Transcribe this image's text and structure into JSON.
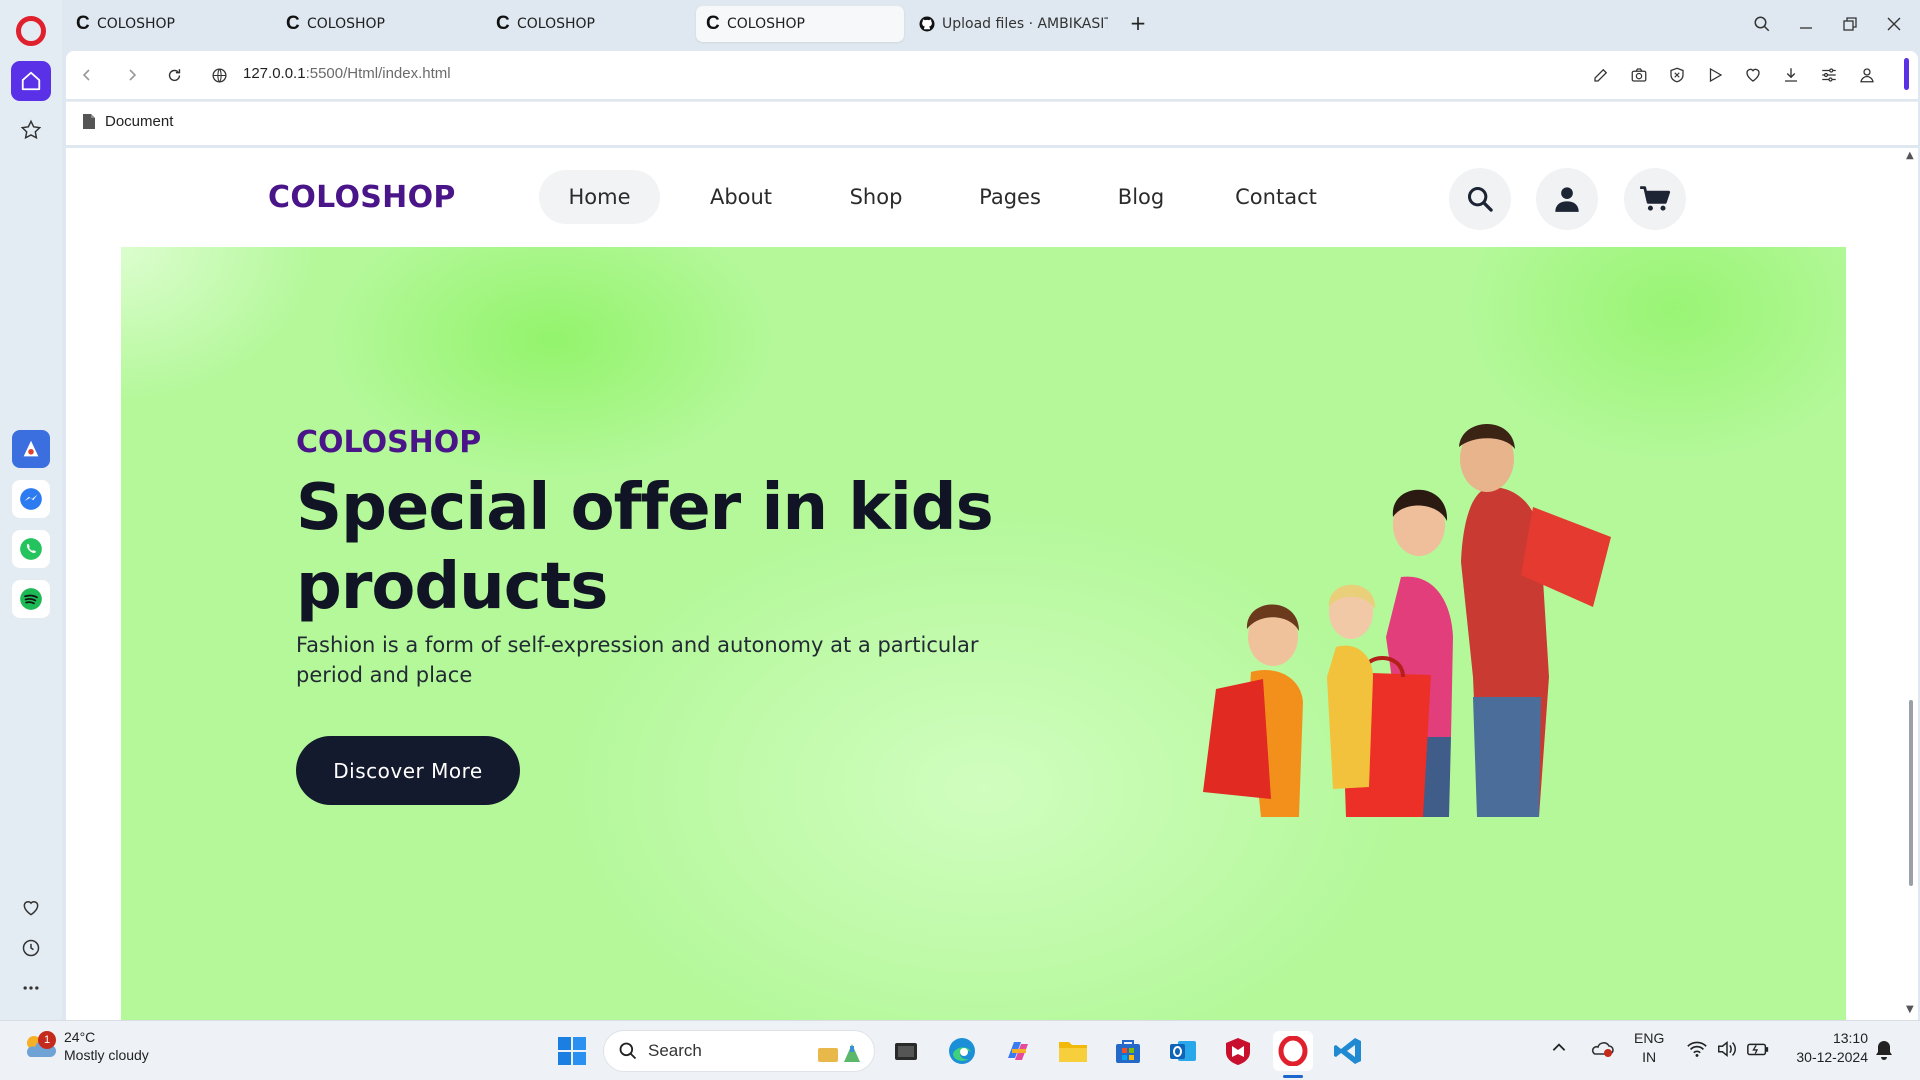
{
  "browser": {
    "tabs": [
      {
        "favicon": "C",
        "title": "COLOSHOP",
        "active": false
      },
      {
        "favicon": "C",
        "title": "COLOSHOP",
        "active": false
      },
      {
        "favicon": "C",
        "title": "COLOSHOP",
        "active": false
      },
      {
        "favicon": "C",
        "title": "COLOSHOP",
        "active": true
      },
      {
        "favicon": "github-icon",
        "title": "Upload files · AMBIKASITH",
        "active": false
      }
    ],
    "new_tab": "+",
    "url_host": "127.0.0.1",
    "url_path": ":5500/Html/index.html",
    "bookmark": "Document",
    "accent": "#5b31e7"
  },
  "site": {
    "logo": "COLOSHOP",
    "menu": [
      "Home",
      "About",
      "Shop",
      "Pages",
      "Blog",
      "Contact"
    ],
    "active_menu": "Home",
    "icons": [
      "search-icon",
      "user-icon",
      "cart-icon"
    ],
    "brand_color": "#4a1588"
  },
  "hero": {
    "kicker": "COLOSHOP",
    "title": "Special offer in kids products",
    "description": "Fashion is a form of self-expression and autonomy at a particular period and place",
    "cta": "Discover More",
    "background": "#b4f89a"
  },
  "taskbar": {
    "weather_badge": "1",
    "temperature": "24°C",
    "condition": "Mostly cloudy",
    "search_placeholder": "Search",
    "lang_1": "ENG",
    "lang_2": "IN",
    "time": "13:10",
    "date": "30-12-2024"
  }
}
